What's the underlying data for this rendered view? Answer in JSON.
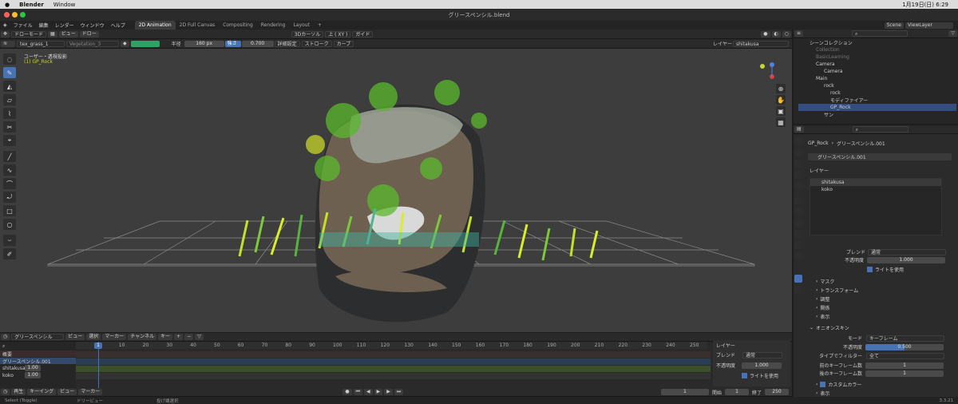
{
  "mac": {
    "app": "Blender",
    "menu": "Window",
    "clock": "1月19日(日) 6:29"
  },
  "window": {
    "title": "グリースペンシル.blend"
  },
  "menu": [
    "ファイル",
    "編集",
    "レンダー",
    "ウィンドウ",
    "ヘルプ"
  ],
  "workspaces": [
    "2D Animation",
    "2D Full Canvas",
    "Compositing",
    "Rendering",
    "Layout"
  ],
  "header": {
    "mode": "ドローモード",
    "view": "ビュー",
    "draw": "ドロー",
    "orient": "3Dカーソル",
    "axis": "上 ( XY )",
    "guide": "ガイド"
  },
  "toolsettings": {
    "brush": "tex_grass_1",
    "material": "Vegetation_3",
    "radius_label": "半径",
    "radius": "160 px",
    "strength_label": "強さ",
    "strength": "0.700",
    "advanced": "詳細設定",
    "stroke": "ストローク",
    "curve": "カーブ",
    "layer_label": "レイヤー",
    "layer": "shitakusa"
  },
  "viewport": {
    "view_name": "ユーザー・透視投影",
    "object": "(1) GP_Rock"
  },
  "timeline": {
    "editor": "グリースペンシル",
    "menus": [
      "ビュー",
      "選択",
      "マーカー",
      "チャンネル",
      "キー"
    ],
    "ticks": [
      "1",
      "10",
      "20",
      "30",
      "40",
      "50",
      "60",
      "70",
      "80",
      "90",
      "100",
      "110",
      "120",
      "130",
      "140",
      "150",
      "160",
      "170",
      "180",
      "190",
      "200",
      "210",
      "220",
      "230",
      "240",
      "250"
    ],
    "summary": "概要",
    "object": "グリースペンシル.001",
    "layers": [
      {
        "name": "shitakusa",
        "value": "1.00"
      },
      {
        "name": "koko",
        "value": "1.00"
      }
    ],
    "panel": {
      "title": "レイヤー",
      "blend_label": "ブレンド",
      "blend": "通常",
      "opacity_label": "不透明度",
      "opacity": "1.000",
      "lights": "ライトを使用"
    }
  },
  "playback": {
    "play": "再生",
    "keying": "キーイング",
    "view": "ビュー",
    "marker": "マーカー",
    "frame": "1",
    "start_label": "開始",
    "start": "1",
    "end_label": "終了",
    "end": "250"
  },
  "status": {
    "select": "Select (Toggle)",
    "dolly": "ドリービュー",
    "lasso": "投げ縄選択",
    "version": "3.3.21"
  },
  "outliner": {
    "scene": "Scene",
    "viewlayer": "ViewLayer",
    "rows": [
      "シーンコレクション",
      "Collection",
      "BasicLearning",
      "Camera",
      "Camera",
      "Main",
      "rock",
      "rock",
      "モディファイアー",
      "GP_Rock",
      "サン"
    ]
  },
  "properties": {
    "breadcrumb_obj": "GP_Rock",
    "breadcrumb_data": "グリースペンシル.001",
    "datablock": "グリースペンシル.001",
    "layers_title": "レイヤー",
    "layers": [
      "shitakusa",
      "koko"
    ],
    "blend_label": "ブレンド",
    "blend": "通常",
    "opacity_label": "不透明度",
    "opacity": "1.000",
    "lights": "ライトを使用",
    "sections": [
      "マスク",
      "トランスフォーム",
      "調整",
      "関係",
      "表示"
    ],
    "onion_title": "オニオンスキン",
    "mode_label": "モード",
    "mode": "キーフレーム",
    "op_label": "不透明度",
    "op": "0.500",
    "filter_label": "タイプでフィルター",
    "filter": "全て",
    "before_label": "前のキーフレーム数",
    "before": "1",
    "after_label": "後のキーフレーム数",
    "after": "1",
    "custom": "カスタムカラー",
    "display": "表示"
  }
}
